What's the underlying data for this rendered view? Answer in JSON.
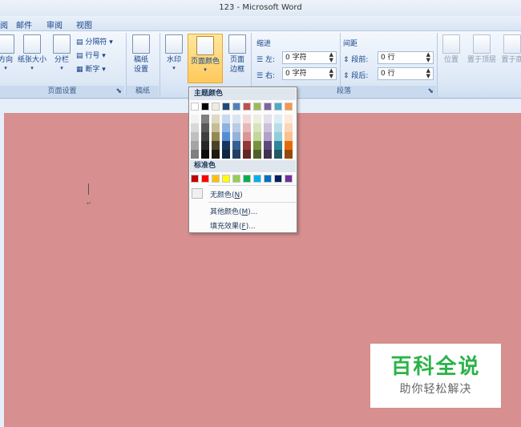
{
  "window": {
    "title": "123 - Microsoft Word"
  },
  "menu": {
    "tabs": [
      "阅",
      "邮件",
      "审阅",
      "视图"
    ]
  },
  "ribbon": {
    "page_setup": {
      "buttons": [
        {
          "label": "方向",
          "has_dropdown": true,
          "icon": "orientation-icon"
        },
        {
          "label": "纸张大小",
          "has_dropdown": true,
          "icon": "paper-size-icon"
        },
        {
          "label": "分栏",
          "has_dropdown": true,
          "icon": "columns-icon"
        }
      ],
      "small": [
        "分隔符 ▾",
        "行号 ▾",
        "断字 ▾"
      ],
      "group_label": "页面设置"
    },
    "paper": {
      "button": {
        "line1": "稿纸",
        "line2": "设置",
        "icon": "manuscript-icon"
      },
      "group_label": "稿纸"
    },
    "background": {
      "buttons": [
        {
          "label": "水印",
          "dd": "▾",
          "icon": "watermark-icon"
        },
        {
          "label": "页面颜色",
          "dd": "▾",
          "icon": "page-color-icon"
        },
        {
          "line1": "页面",
          "line2": "边框",
          "icon": "page-borders-icon"
        }
      ]
    },
    "paragraph": {
      "indent_header": "缩进",
      "indent_left_label": "左:",
      "indent_left_value": "0 字符",
      "indent_right_label": "右:",
      "indent_right_value": "0 字符",
      "spacing_header": "间距",
      "spacing_before_label": "段前:",
      "spacing_before_value": "0 行",
      "spacing_after_label": "段后:",
      "spacing_after_value": "0 行",
      "group_label": "段落"
    },
    "arrange": {
      "buttons": [
        {
          "label": "位置",
          "icon": "position-icon"
        },
        {
          "label": "置于顶层",
          "icon": "bring-front-icon"
        },
        {
          "label": "置于底",
          "icon": "send-back-icon"
        }
      ]
    }
  },
  "color_popup": {
    "theme_header": "主题颜色",
    "standard_header": "标准色",
    "theme_colors": [
      "#ffffff",
      "#000000",
      "#eeece1",
      "#1f497d",
      "#4f81bd",
      "#c0504d",
      "#9bbb59",
      "#8064a2",
      "#4bacc6",
      "#f79646"
    ],
    "theme_shades": [
      [
        "#f2f2f2",
        "#d8d8d8",
        "#bfbfbf",
        "#a5a5a5",
        "#7f7f7f"
      ],
      [
        "#7f7f7f",
        "#595959",
        "#3f3f3f",
        "#262626",
        "#0c0c0c"
      ],
      [
        "#ddd9c3",
        "#c4bd97",
        "#938953",
        "#494429",
        "#1d1b10"
      ],
      [
        "#c6d9f0",
        "#8db3e2",
        "#548dd4",
        "#17365d",
        "#0f243e"
      ],
      [
        "#dbe5f1",
        "#b8cce4",
        "#95b3d7",
        "#366092",
        "#244061"
      ],
      [
        "#f2dcdb",
        "#e5b9b7",
        "#d99694",
        "#953734",
        "#632423"
      ],
      [
        "#ebf1dd",
        "#d7e3bc",
        "#c3d69b",
        "#76923c",
        "#4f6128"
      ],
      [
        "#e5e0ec",
        "#ccc1d9",
        "#b2a2c7",
        "#5f497a",
        "#3f3151"
      ],
      [
        "#dbeef3",
        "#b7dde8",
        "#92cddc",
        "#31859b",
        "#205867"
      ],
      [
        "#fdeada",
        "#fbd5b5",
        "#fac08f",
        "#e36c09",
        "#974806"
      ]
    ],
    "standard_colors": [
      "#c00000",
      "#ff0000",
      "#ffc000",
      "#ffff00",
      "#92d050",
      "#00b050",
      "#00b0f0",
      "#0070c0",
      "#002060",
      "#7030a0"
    ],
    "no_color": {
      "text": "无颜色(",
      "key": "N",
      "tail": ")"
    },
    "more_colors": {
      "text": "其他颜色(",
      "key": "M",
      "tail": ")..."
    },
    "fill_effects": {
      "text": "填充效果(",
      "key": "F",
      "tail": ")..."
    }
  },
  "watermark": {
    "title": "百科全说",
    "subtitle": "助你轻松解决"
  }
}
